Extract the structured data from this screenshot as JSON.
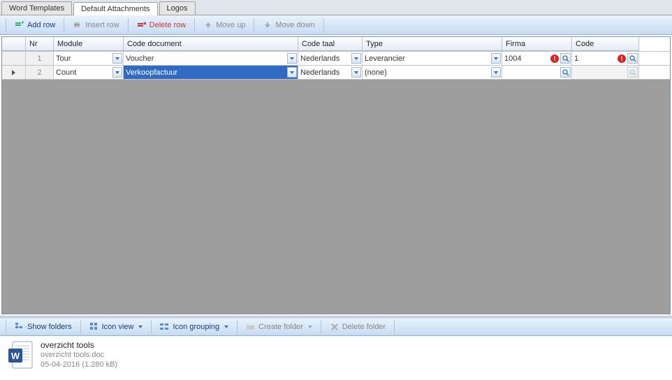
{
  "tabs": [
    {
      "label": "Word Templates",
      "active": false
    },
    {
      "label": "Default Attachments",
      "active": true
    },
    {
      "label": "Logos",
      "active": false
    }
  ],
  "toolbar": {
    "add_row": "Add row",
    "insert_row": "Insert row",
    "delete_row": "Delete row",
    "move_up": "Move up",
    "move_down": "Move down"
  },
  "grid": {
    "columns": {
      "nr": "Nr",
      "module": "Module",
      "code_document": "Code document",
      "code_taal": "Code taal",
      "type": "Type",
      "firma": "Firma",
      "code": "Code"
    },
    "rows": [
      {
        "nr": "1",
        "module": "Tour",
        "code_document": "Voucher",
        "code_taal": "Nederlands",
        "type": "Leverancier",
        "firma": "1004",
        "firma_error": true,
        "code": "1",
        "code_error": true,
        "selected": false,
        "current": false
      },
      {
        "nr": "2",
        "module": "Count",
        "code_document": "Verkoopfactuur",
        "code_taal": "Nederlands",
        "type": "(none)",
        "firma": "",
        "firma_error": false,
        "code": "",
        "code_error": false,
        "selected": "code_document",
        "current": true
      }
    ]
  },
  "filebar": {
    "show_folders": "Show folders",
    "icon_view": "Icon view",
    "icon_grouping": "Icon grouping",
    "create_folder": "Create folder",
    "delete_folder": "Delete folder"
  },
  "file": {
    "title": "overzicht tools",
    "filename": "overzicht tools.doc",
    "meta": "05-04-2016 (1.280 kB)"
  }
}
